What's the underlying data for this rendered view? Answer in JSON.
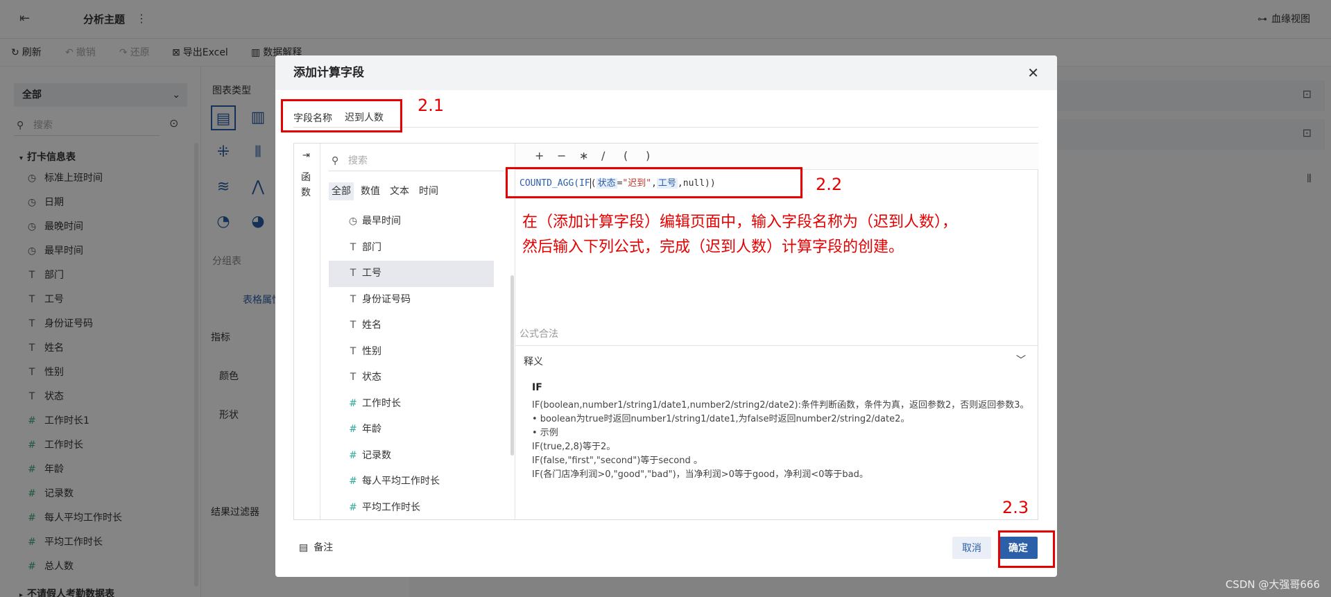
{
  "topbar": {
    "title": "分析主题",
    "lineage_label": "血缘视图"
  },
  "toolbar": {
    "refresh": "刷新",
    "undo": "撤销",
    "redo": "还原",
    "export_excel": "导出Excel",
    "data_explain": "数据解释"
  },
  "left_panel": {
    "select_value": "全部",
    "search_placeholder": "搜索",
    "group_name": "打卡信息表",
    "items": [
      {
        "icon": "clock-icon",
        "label": "标准上班时间"
      },
      {
        "icon": "clock-icon",
        "label": "日期"
      },
      {
        "icon": "clock-icon",
        "label": "最晚时间"
      },
      {
        "icon": "clock-icon",
        "label": "最早时间"
      },
      {
        "icon": "text-icon",
        "label": "部门"
      },
      {
        "icon": "text-icon",
        "label": "工号"
      },
      {
        "icon": "text-icon",
        "label": "身份证号码"
      },
      {
        "icon": "text-icon",
        "label": "姓名"
      },
      {
        "icon": "text-icon",
        "label": "性别"
      },
      {
        "icon": "text-icon",
        "label": "状态"
      },
      {
        "icon": "number-icon",
        "label": "工作时长1"
      },
      {
        "icon": "number-icon",
        "label": "工作时长"
      },
      {
        "icon": "number-icon",
        "label": "年龄"
      },
      {
        "icon": "calc-number-icon",
        "label": "记录数"
      },
      {
        "icon": "calc-number-icon",
        "label": "每人平均工作时长"
      },
      {
        "icon": "calc-number-icon",
        "label": "平均工作时长"
      },
      {
        "icon": "calc-number-icon",
        "label": "总人数"
      }
    ],
    "bottom_group": "不请假人考勤数据表"
  },
  "mid_panel": {
    "chart_type_label": "图表类型",
    "group_table": "分组表",
    "table_attr_tab": "表格属性",
    "metric_label": "指标",
    "color_label": "颜色",
    "shape_label": "形状",
    "result_filter": "结果过滤器"
  },
  "modal": {
    "title": "添加计算字段",
    "field_name_label": "字段名称",
    "field_name_value": "迟到人数",
    "rail_label": "函数",
    "search_placeholder": "搜索",
    "tabs": [
      "全部",
      "数值",
      "文本",
      "时间"
    ],
    "active_tab": 0,
    "fields": [
      {
        "icon": "clock-icon",
        "label": "最早时间"
      },
      {
        "icon": "text-icon",
        "label": "部门"
      },
      {
        "icon": "text-icon",
        "label": "工号"
      },
      {
        "icon": "text-icon",
        "label": "身份证号码"
      },
      {
        "icon": "text-icon",
        "label": "姓名"
      },
      {
        "icon": "text-icon",
        "label": "性别"
      },
      {
        "icon": "text-icon",
        "label": "状态"
      },
      {
        "icon": "number-icon",
        "label": "工作时长"
      },
      {
        "icon": "number-icon",
        "label": "年龄"
      },
      {
        "icon": "calc-number-icon",
        "label": "记录数"
      },
      {
        "icon": "calc-number-icon",
        "label": "每人平均工作时长"
      },
      {
        "icon": "calc-number-icon",
        "label": "平均工作时长"
      }
    ],
    "active_field": 2,
    "operators": [
      "+",
      "−",
      "∗",
      "/",
      "(",
      ")"
    ],
    "formula": {
      "fn": "COUNTD_AGG(",
      "if_kw": "IF",
      "open": "(",
      "field1": "状态",
      "eq": "=",
      "str": "\"迟到\"",
      "comma1": ",",
      "field2": "工号",
      "rest": ",null))"
    },
    "annotation_line1": "在（添加计算字段）编辑页面中，输入字段名称为（迟到人数），",
    "annotation_line2": "然后输入下列公式，完成（迟到人数）计算字段的创建。",
    "validity": "公式合法",
    "explain_title": "释义",
    "explain": {
      "name": "IF",
      "line1": "IF(boolean,number1/string1/date1,number2/string2/date2):条件判断函数，条件为真，返回参数2，否则返回参数3。",
      "line2": "• boolean为true时返回number1/string1/date1,为false时返回number2/string2/date2。",
      "line3": "• 示例",
      "line4": "IF(true,2,8)等于2。",
      "line5": "IF(false,\"first\",\"second\")等于second 。",
      "line6": "IF(各门店净利润>0,\"good\",\"bad\")，当净利润>0等于good，净利润<0等于bad。"
    },
    "note_label": "备注",
    "cancel_label": "取消",
    "ok_label": "确定"
  },
  "annotations": {
    "label_2_1": "2.1",
    "label_2_2": "2.2",
    "label_2_3": "2.3",
    "color": "#e60000"
  },
  "watermark": "CSDN @大强哥666",
  "colors": {
    "primary": "#2b5fa8",
    "annotation_red": "#e60000"
  }
}
